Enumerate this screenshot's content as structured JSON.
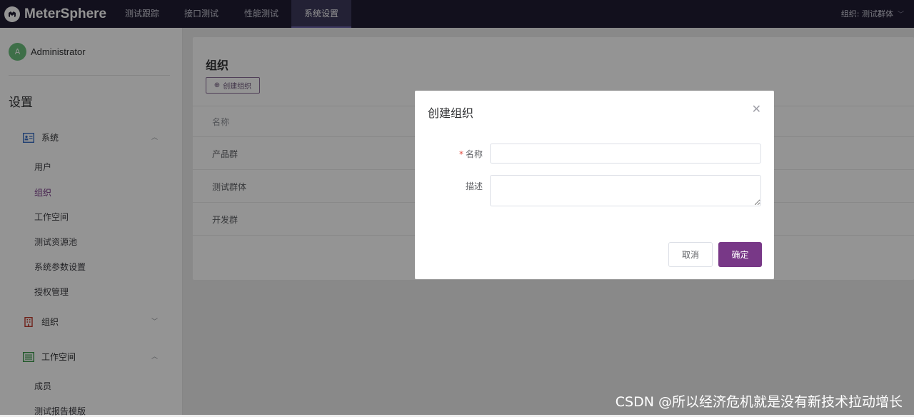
{
  "app": {
    "name": "MeterSphere"
  },
  "topnav": {
    "items": [
      {
        "label": "测试跟踪"
      },
      {
        "label": "接口测试"
      },
      {
        "label": "性能测试"
      },
      {
        "label": "系统设置"
      }
    ],
    "active_index": 3,
    "org_switch": "组织: 测试群体"
  },
  "sidebar": {
    "user": {
      "avatar_letter": "A",
      "name": "Administrator"
    },
    "title": "设置",
    "groups": [
      {
        "label": "系统",
        "expanded": true,
        "icon": "id-card-icon",
        "items": [
          "用户",
          "组织",
          "工作空间",
          "测试资源池",
          "系统参数设置",
          "授权管理"
        ]
      },
      {
        "label": "组织",
        "expanded": false,
        "icon": "building-icon",
        "items": []
      },
      {
        "label": "工作空间",
        "expanded": true,
        "icon": "list-icon",
        "items": [
          "成员",
          "测试报告模版"
        ]
      }
    ]
  },
  "main": {
    "title": "组织",
    "create_button": "创建组织",
    "table": {
      "header": "名称",
      "rows": [
        "产品群",
        "测试群体",
        "开发群"
      ]
    }
  },
  "dialog": {
    "title": "创建组织",
    "fields": [
      {
        "label": "名称",
        "required": true,
        "value": ""
      },
      {
        "label": "描述",
        "required": false,
        "value": ""
      }
    ],
    "cancel": "取消",
    "confirm": "确定"
  },
  "watermark": "CSDN @所以经济危机就是没有新技术拉动增长",
  "colors": {
    "topbar": "#1f1d32",
    "primary": "#783887",
    "overlay": "rgba(0,0,0,0.42)"
  }
}
